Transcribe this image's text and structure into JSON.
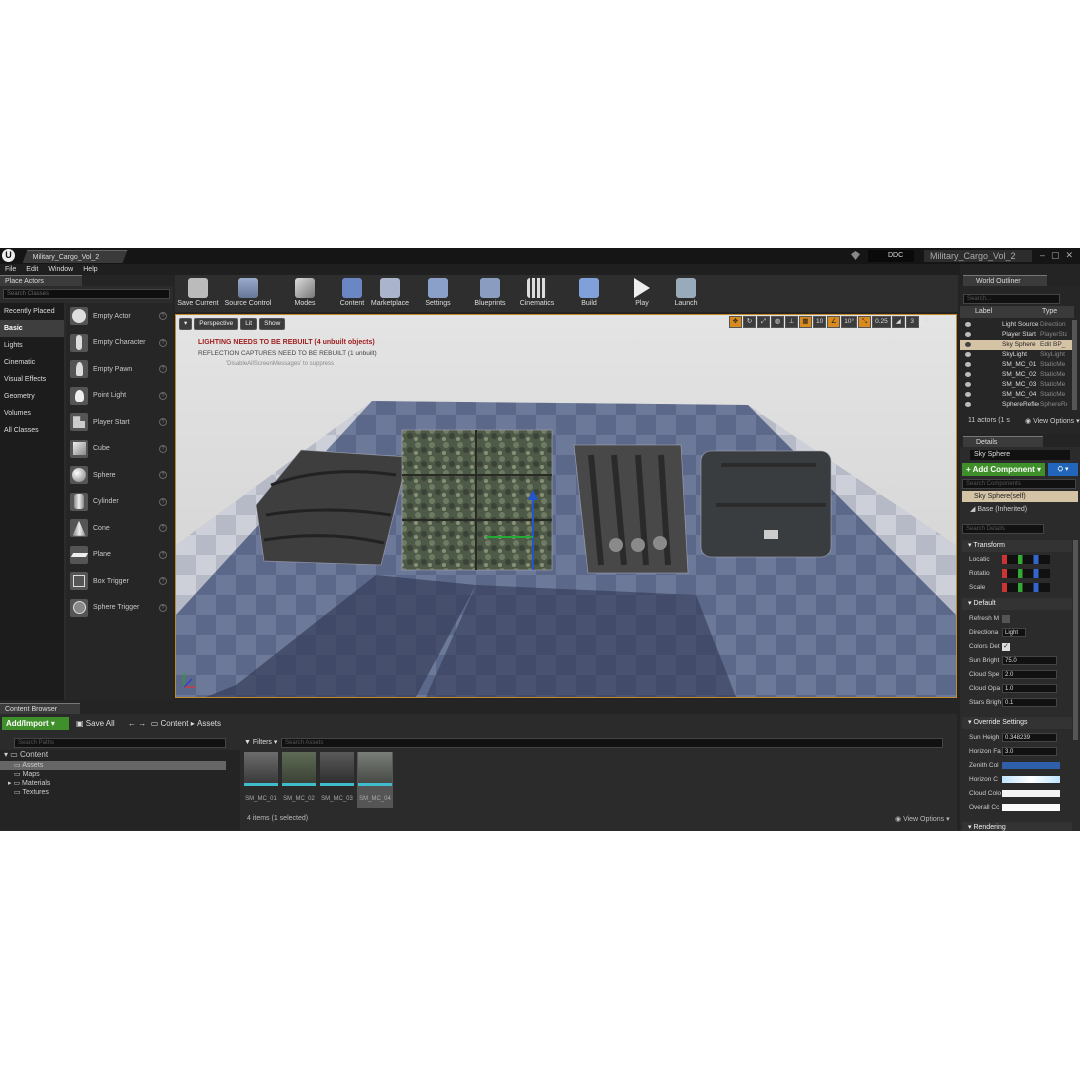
{
  "window": {
    "doc_tab": "Military_Cargo_Vol_2",
    "ddc": "DDC",
    "project": "Military_Cargo_Vol_2"
  },
  "menu": [
    "File",
    "Edit",
    "Window",
    "Help"
  ],
  "place_actors": {
    "tab": "Place Actors",
    "search_placeholder": "Search Classes",
    "categories": [
      "Recently Placed",
      "Basic",
      "Lights",
      "Cinematic",
      "Visual Effects",
      "Geometry",
      "Volumes",
      "All Classes"
    ],
    "actors": [
      "Empty Actor",
      "Empty Character",
      "Empty Pawn",
      "Point Light",
      "Player Start",
      "Cube",
      "Sphere",
      "Cylinder",
      "Cone",
      "Plane",
      "Box Trigger",
      "Sphere Trigger"
    ]
  },
  "toolbar": {
    "save_current": "Save Current",
    "source_control": "Source Control",
    "modes": "Modes",
    "content": "Content",
    "marketplace": "Marketplace",
    "settings": "Settings",
    "blueprints": "Blueprints",
    "cinematics": "Cinematics",
    "build": "Build",
    "play": "Play",
    "launch": "Launch"
  },
  "viewport": {
    "perspective": "Perspective",
    "lit": "Lit",
    "show": "Show",
    "msg_lighting": "LIGHTING NEEDS TO BE REBUILT (4 unbuilt objects)",
    "msg_reflection": "REFLECTION CAPTURES NEED TO BE REBUILT (1 unbuilt)",
    "msg_suppress": "'DisableAllScreenMessages' to suppress",
    "grid": "10",
    "rot": "10°",
    "scale": "0.25",
    "cam": "3"
  },
  "content_browser": {
    "tab": "Content Browser",
    "add_import": "Add/Import",
    "save_all": "Save All",
    "crumb_root": "Content",
    "crumb_leaf": "Assets",
    "search_paths": "Search Paths",
    "filters": "Filters",
    "search_assets": "Search Assets",
    "tree": [
      "Content",
      "Assets",
      "Maps",
      "Materials",
      "Textures"
    ],
    "assets": [
      "SM_MC_01",
      "SM_MC_02",
      "SM_MC_03",
      "SM_MC_04"
    ],
    "item_count": "4 items (1 selected)",
    "view_options": "View Options"
  },
  "world_outliner": {
    "tab": "World Outliner",
    "search": "Search...",
    "col_label": "Label",
    "col_type": "Type",
    "rows": [
      {
        "label": "Light Source",
        "type": "Direction"
      },
      {
        "label": "Player Start",
        "type": "PlayerSta"
      },
      {
        "label": "Sky Sphere",
        "type": "Edit BP_"
      },
      {
        "label": "SkyLight",
        "type": "SkyLight"
      },
      {
        "label": "SM_MC_01",
        "type": "StaticMe"
      },
      {
        "label": "SM_MC_02",
        "type": "StaticMe"
      },
      {
        "label": "SM_MC_03",
        "type": "StaticMe"
      },
      {
        "label": "SM_MC_04",
        "type": "StaticMe"
      },
      {
        "label": "SphereReflec",
        "type": "SphereRe"
      }
    ],
    "count": "11 actors (1 s",
    "view_options": "View Options"
  },
  "details": {
    "tab": "Details",
    "name": "Sky Sphere",
    "add_component": "+ Add Component",
    "search_components": "Search Components",
    "comp_self": "Sky Sphere(self)",
    "comp_base": "Base (Inherited)",
    "search_details": "Search Details",
    "transform": "Transform",
    "location": "Locatic",
    "rotation": "Rotatio",
    "scale": "Scale",
    "default": "Default",
    "refresh": "Refresh M",
    "directional": "Directiona",
    "directional_val": "Light",
    "colors": "Colors Det",
    "sun_bright": "Sun Bright",
    "sun_bright_val": "75.0",
    "cloud_speed": "Cloud Spe",
    "cloud_speed_val": "2.0",
    "cloud_opacity": "Cloud Opa",
    "cloud_opacity_val": "1.0",
    "stars": "Stars Brigh",
    "stars_val": "0.1",
    "override": "Override Settings",
    "sun_height": "Sun Heigh",
    "sun_height_val": "0.348239",
    "horizon_f": "Horizon Fa",
    "horizon_f_val": "3.0",
    "zenith": "Zenith Col",
    "horizon_c": "Horizon C",
    "cloud_color": "Cloud Colo",
    "overall": "Overall Cc",
    "rendering": "Rendering"
  },
  "colors": {
    "accent_green": "#3f8f2a",
    "viewport_border": "#c28a2d",
    "error_red": "#a02020",
    "selection": "#d5c3a6"
  }
}
